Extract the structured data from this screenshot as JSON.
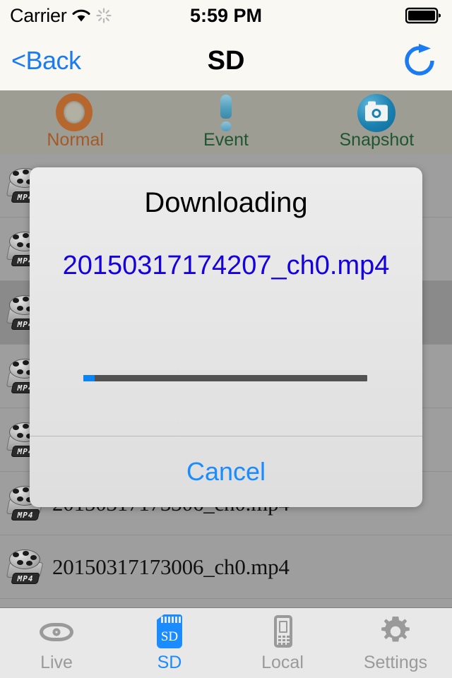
{
  "status_bar": {
    "carrier": "Carrier",
    "time": "5:59 PM",
    "wifi_icon": "wifi-icon",
    "activity_icon": "activity-spinner-icon",
    "battery_icon": "battery-full-icon"
  },
  "nav_bar": {
    "back_label": "<Back",
    "title": "SD",
    "refresh_icon": "refresh-icon"
  },
  "categories": [
    {
      "label": "Normal",
      "icon": "normal-ring-icon"
    },
    {
      "label": "Event",
      "icon": "event-exclamation-icon"
    },
    {
      "label": "Snapshot",
      "icon": "snapshot-camera-icon"
    }
  ],
  "file_list": {
    "badge": "MP4",
    "rows": [
      {
        "name": "",
        "selected": false
      },
      {
        "name": "",
        "selected": false
      },
      {
        "name": "",
        "selected": true
      },
      {
        "name": "",
        "selected": false
      },
      {
        "name": "",
        "selected": false
      },
      {
        "name": "20150317173306_ch0.mp4",
        "selected": false
      },
      {
        "name": "20150317173006_ch0.mp4",
        "selected": false
      }
    ]
  },
  "dialog": {
    "title": "Downloading",
    "filename": "20150317174207_ch0.mp4",
    "cancel_label": "Cancel",
    "progress_percent": 4,
    "progress_fill_color": "#0b84f5",
    "progress_track_color": "#525252",
    "filename_color": "#1500e0"
  },
  "tab_bar": {
    "active": "SD",
    "items": [
      {
        "label": "Live",
        "icon": "eye-icon"
      },
      {
        "label": "SD",
        "icon": "sd-card-icon"
      },
      {
        "label": "Local",
        "icon": "phone-icon"
      },
      {
        "label": "Settings",
        "icon": "gear-icon"
      }
    ]
  }
}
